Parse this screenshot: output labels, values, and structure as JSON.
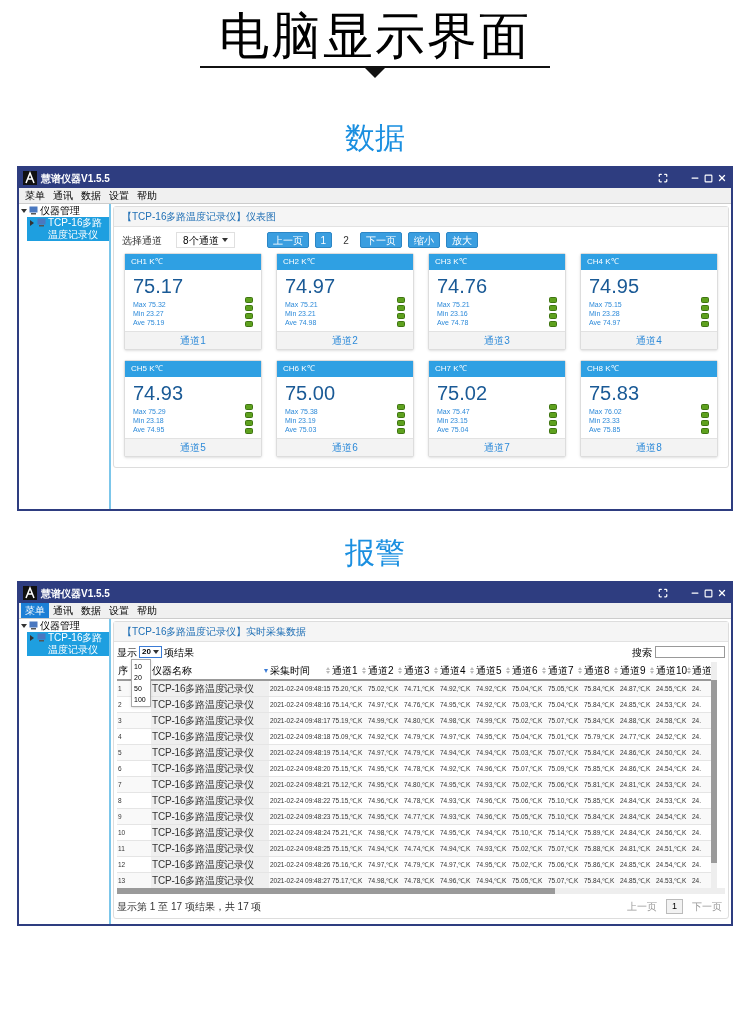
{
  "page_title": "电脑显示界面",
  "dashboard_section": {
    "heading": "数据",
    "window": {
      "title": "慧谱仪器V1.5.5",
      "menu": [
        {
          "label": "菜单",
          "selected": false
        },
        {
          "label": "通讯",
          "selected": false
        },
        {
          "label": "数据",
          "selected": false
        },
        {
          "label": "设置",
          "selected": false
        },
        {
          "label": "帮助",
          "selected": false
        }
      ],
      "tree": [
        {
          "label": "仪器管理",
          "expanded": true,
          "selected": false,
          "children": [
            {
              "label": "TCP-16多路温度记录仪",
              "expanded": false,
              "selected": true
            }
          ]
        }
      ],
      "panel_title": "【TCP-16多路温度记录仪】仪表图",
      "channel_label": "选择通道",
      "channel_select": "8个通道",
      "pager": [
        {
          "label": "上一页",
          "kind": "button"
        },
        {
          "label": "1",
          "kind": "page",
          "selected": true
        },
        {
          "label": "2",
          "kind": "page",
          "selected": false
        },
        {
          "label": "下一页",
          "kind": "button"
        },
        {
          "label": "缩小",
          "kind": "button"
        },
        {
          "label": "放大",
          "kind": "button"
        }
      ],
      "cards": [
        {
          "header": "CH1 K℃",
          "value": "75.17",
          "stats": [
            "Max 75.32",
            "Min 23.27",
            "Ave 75.19"
          ],
          "footer": "通道1"
        },
        {
          "header": "CH2 K℃",
          "value": "74.97",
          "stats": [
            "Max 75.21",
            "Min 23.21",
            "Ave 74.98"
          ],
          "footer": "通道2"
        },
        {
          "header": "CH3 K℃",
          "value": "74.76",
          "stats": [
            "Max 75.21",
            "Min 23.16",
            "Ave 74.78"
          ],
          "footer": "通道3"
        },
        {
          "header": "CH4 K℃",
          "value": "74.95",
          "stats": [
            "Max 75.15",
            "Min 23.28",
            "Ave 74.97"
          ],
          "footer": "通道4"
        },
        {
          "header": "CH5 K℃",
          "value": "74.93",
          "stats": [
            "Max 75.29",
            "Min 23.18",
            "Ave 74.95"
          ],
          "footer": "通道5"
        },
        {
          "header": "CH6 K℃",
          "value": "75.00",
          "stats": [
            "Max 75.38",
            "Min 23.19",
            "Ave 75.03"
          ],
          "footer": "通道6"
        },
        {
          "header": "CH7 K℃",
          "value": "75.02",
          "stats": [
            "Max 75.47",
            "Min 23.15",
            "Ave 75.04"
          ],
          "footer": "通道7"
        },
        {
          "header": "CH8 K℃",
          "value": "75.83",
          "stats": [
            "Max 76.02",
            "Min 23.33",
            "Ave 75.85"
          ],
          "footer": "通道8"
        }
      ]
    }
  },
  "table_section": {
    "heading": "报警",
    "window": {
      "title": "慧谱仪器V1.5.5",
      "menu": [
        {
          "label": "菜单",
          "selected": true
        },
        {
          "label": "通讯",
          "selected": false
        },
        {
          "label": "数据",
          "selected": false
        },
        {
          "label": "设置",
          "selected": false
        },
        {
          "label": "帮助",
          "selected": false
        }
      ],
      "tree": [
        {
          "label": "仪器管理",
          "expanded": true,
          "selected": false,
          "children": [
            {
              "label": "TCP-16多路温度记录仪",
              "expanded": false,
              "selected": true
            }
          ]
        }
      ],
      "panel_title": "【TCP-16多路温度记录仪】实时采集数据",
      "page_length": {
        "label_before": "显示",
        "value": "20",
        "label_after": "项结果",
        "expanded": true,
        "options": [
          "10",
          "20",
          "50",
          "100"
        ]
      },
      "search_label": "搜索",
      "columns": [
        {
          "label": "序"
        },
        {
          "label": "仪器名称",
          "sortable": true,
          "sorted": true
        },
        {
          "label": "采集时间",
          "sortable": true,
          "sorted": false
        },
        {
          "label": "通道1",
          "sortable": true,
          "sorted": false
        },
        {
          "label": "通道2",
          "sortable": true,
          "sorted": false
        },
        {
          "label": "通道3",
          "sortable": true,
          "sorted": false
        },
        {
          "label": "通道4",
          "sortable": true,
          "sorted": false
        },
        {
          "label": "通道5",
          "sortable": true,
          "sorted": false
        },
        {
          "label": "通道6",
          "sortable": true,
          "sorted": false
        },
        {
          "label": "通道7",
          "sortable": true,
          "sorted": false
        },
        {
          "label": "通道8",
          "sortable": true,
          "sorted": false
        },
        {
          "label": "通道9",
          "sortable": true,
          "sorted": false
        },
        {
          "label": "通道10",
          "sortable": true,
          "sorted": false
        },
        {
          "label": "通道"
        }
      ],
      "rows": [
        [
          "1",
          "TCP-16多路温度记录仪",
          "2021-02-24 09:48:15",
          "75.20,℃,K",
          "75.02,℃,K",
          "74.71,℃,K",
          "74.92,℃,K",
          "74.92,℃,K",
          "75.04,℃,K",
          "75.05,℃,K",
          "75.84,℃,K",
          "24.87,℃,K",
          "24.55,℃,K",
          "24."
        ],
        [
          "2",
          "TCP-16多路温度记录仪",
          "2021-02-24 09:48:16",
          "75.14,℃,K",
          "74.97,℃,K",
          "74.76,℃,K",
          "74.95,℃,K",
          "74.92,℃,K",
          "75.03,℃,K",
          "75.04,℃,K",
          "75.84,℃,K",
          "24.85,℃,K",
          "24.53,℃,K",
          "24."
        ],
        [
          "3",
          "TCP-16多路温度记录仪",
          "2021-02-24 09:48:17",
          "75.19,℃,K",
          "74.99,℃,K",
          "74.80,℃,K",
          "74.98,℃,K",
          "74.99,℃,K",
          "75.02,℃,K",
          "75.07,℃,K",
          "75.84,℃,K",
          "24.88,℃,K",
          "24.58,℃,K",
          "24."
        ],
        [
          "4",
          "TCP-16多路温度记录仪",
          "2021-02-24 09:48:18",
          "75.09,℃,K",
          "74.92,℃,K",
          "74.79,℃,K",
          "74.97,℃,K",
          "74.95,℃,K",
          "75.04,℃,K",
          "75.01,℃,K",
          "75.79,℃,K",
          "24.77,℃,K",
          "24.52,℃,K",
          "24."
        ],
        [
          "5",
          "TCP-16多路温度记录仪",
          "2021-02-24 09:48:19",
          "75.14,℃,K",
          "74.97,℃,K",
          "74.79,℃,K",
          "74.94,℃,K",
          "74.94,℃,K",
          "75.03,℃,K",
          "75.07,℃,K",
          "75.84,℃,K",
          "24.86,℃,K",
          "24.50,℃,K",
          "24."
        ],
        [
          "6",
          "TCP-16多路温度记录仪",
          "2021-02-24 09:48:20",
          "75.15,℃,K",
          "74.95,℃,K",
          "74.78,℃,K",
          "74.92,℃,K",
          "74.96,℃,K",
          "75.07,℃,K",
          "75.09,℃,K",
          "75.85,℃,K",
          "24.86,℃,K",
          "24.54,℃,K",
          "24."
        ],
        [
          "7",
          "TCP-16多路温度记录仪",
          "2021-02-24 09:48:21",
          "75.12,℃,K",
          "74.95,℃,K",
          "74.80,℃,K",
          "74.95,℃,K",
          "74.93,℃,K",
          "75.02,℃,K",
          "75.06,℃,K",
          "75.81,℃,K",
          "24.81,℃,K",
          "24.53,℃,K",
          "24."
        ],
        [
          "8",
          "TCP-16多路温度记录仪",
          "2021-02-24 09:48:22",
          "75.15,℃,K",
          "74.96,℃,K",
          "74.78,℃,K",
          "74.93,℃,K",
          "74.96,℃,K",
          "75.06,℃,K",
          "75.10,℃,K",
          "75.85,℃,K",
          "24.84,℃,K",
          "24.53,℃,K",
          "24."
        ],
        [
          "9",
          "TCP-16多路温度记录仪",
          "2021-02-24 09:48:23",
          "75.15,℃,K",
          "74.95,℃,K",
          "74.77,℃,K",
          "74.93,℃,K",
          "74.96,℃,K",
          "75.05,℃,K",
          "75.10,℃,K",
          "75.84,℃,K",
          "24.84,℃,K",
          "24.54,℃,K",
          "24."
        ],
        [
          "10",
          "TCP-16多路温度记录仪",
          "2021-02-24 09:48:24",
          "75.21,℃,K",
          "74.98,℃,K",
          "74.79,℃,K",
          "74.95,℃,K",
          "74.94,℃,K",
          "75.10,℃,K",
          "75.14,℃,K",
          "75.89,℃,K",
          "24.84,℃,K",
          "24.56,℃,K",
          "24."
        ],
        [
          "11",
          "TCP-16多路温度记录仪",
          "2021-02-24 09:48:25",
          "75.15,℃,K",
          "74.94,℃,K",
          "74.74,℃,K",
          "74.94,℃,K",
          "74.93,℃,K",
          "75.02,℃,K",
          "75.07,℃,K",
          "75.88,℃,K",
          "24.81,℃,K",
          "24.51,℃,K",
          "24."
        ],
        [
          "12",
          "TCP-16多路温度记录仪",
          "2021-02-24 09:48:26",
          "75.16,℃,K",
          "74.97,℃,K",
          "74.79,℃,K",
          "74.97,℃,K",
          "74.95,℃,K",
          "75.02,℃,K",
          "75.06,℃,K",
          "75.86,℃,K",
          "24.85,℃,K",
          "24.54,℃,K",
          "24."
        ],
        [
          "13",
          "TCP-16多路温度记录仪",
          "2021-02-24 09:48:27",
          "75.17,℃,K",
          "74.98,℃,K",
          "74.78,℃,K",
          "74.96,℃,K",
          "74.94,℃,K",
          "75.05,℃,K",
          "75.07,℃,K",
          "75.84,℃,K",
          "24.85,℃,K",
          "24.53,℃,K",
          "24."
        ]
      ],
      "info": "显示第 1 至 17 项结果，共 17 项",
      "pager": [
        {
          "label": "上一页",
          "kind": "button",
          "disabled": true
        },
        {
          "label": "1",
          "kind": "page",
          "selected": true
        },
        {
          "label": "下一页",
          "kind": "button",
          "disabled": true
        }
      ]
    }
  }
}
